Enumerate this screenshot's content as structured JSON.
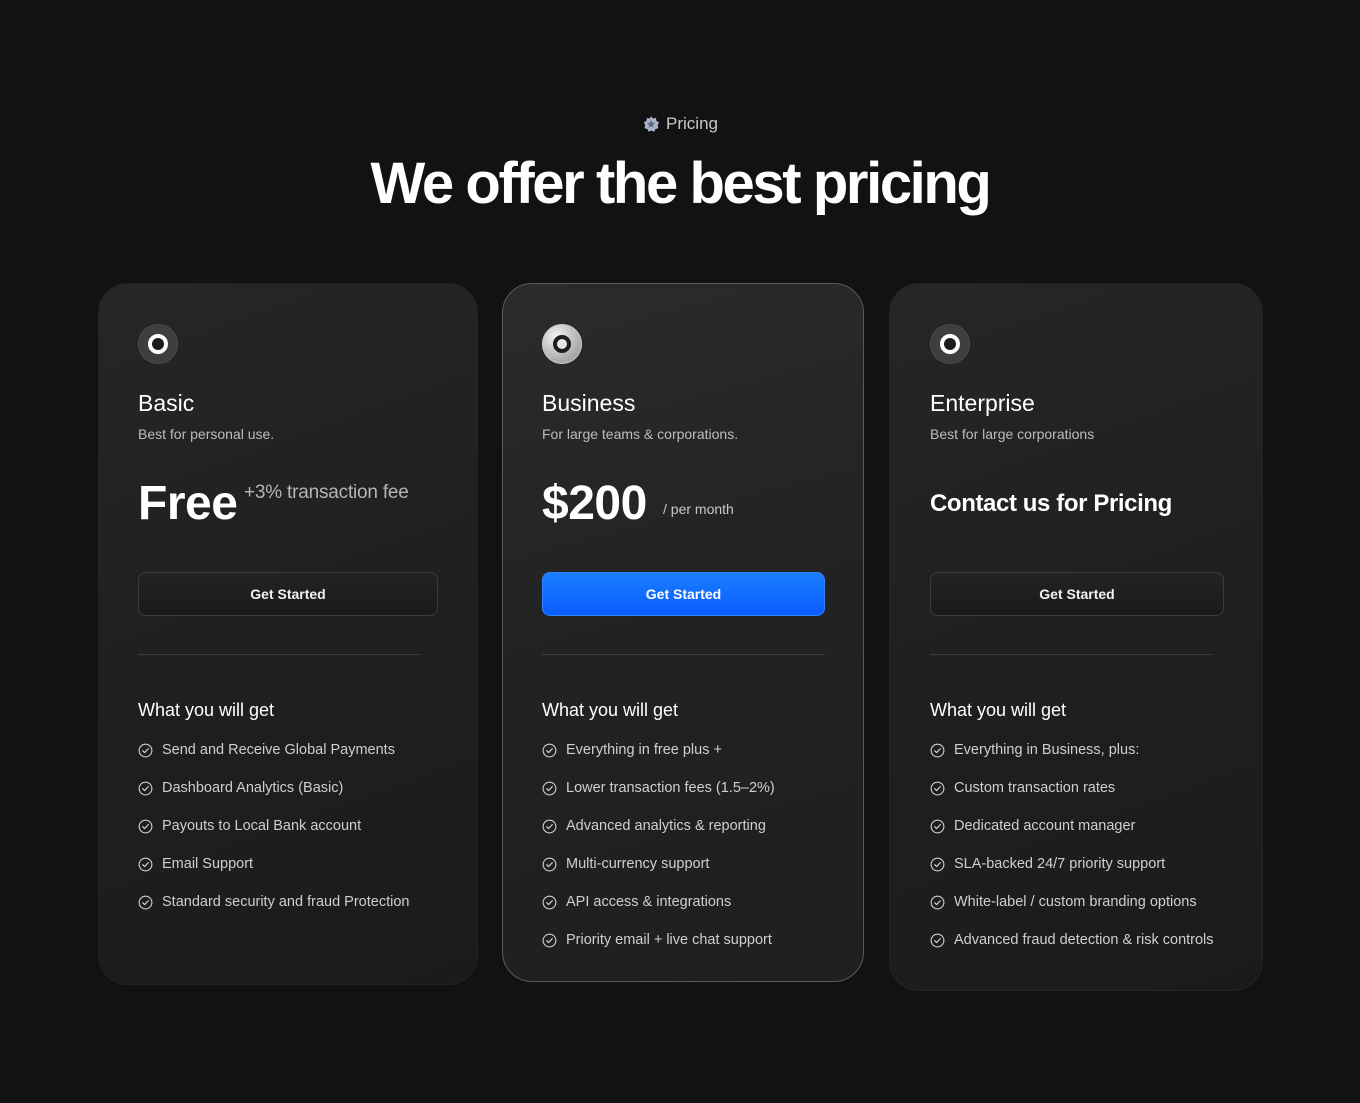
{
  "header": {
    "eyebrow": "Pricing",
    "eyebrow_icon": "badge-star-icon",
    "title": "We offer the best pricing"
  },
  "colors": {
    "background": "#121212",
    "card": "#222222",
    "accent_blue": "#0a63ff",
    "text_muted": "#bdbdbd"
  },
  "plans": [
    {
      "name": "Basic",
      "description": "Best for personal use.",
      "price": "Free",
      "price_note": "+3% transaction fee",
      "cta": "Get Started",
      "features_title": "What you will get",
      "features": [
        "Send and Receive Global Payments",
        "Dashboard Analytics (Basic)",
        "Payouts to Local Bank account",
        "Email Support",
        "Standard security and fraud Protection"
      ]
    },
    {
      "name": "Business",
      "description": "For large teams & corporations.",
      "price": "$200",
      "price_note": "/ per month",
      "cta": "Get Started",
      "features_title": "What you will get",
      "features": [
        "Everything in free plus +",
        "Lower transaction fees (1.5–2%)",
        "Advanced analytics & reporting",
        "Multi-currency support",
        "API access & integrations",
        "Priority email + live chat support"
      ]
    },
    {
      "name": "Enterprise",
      "description": "Best for large corporations",
      "price": "Contact us for Pricing",
      "cta": "Get Started",
      "features_title": "What you will get",
      "features": [
        "Everything in Business, plus:",
        "Custom transaction rates",
        "Dedicated account manager",
        "SLA-backed 24/7 priority support",
        "White-label / custom branding options",
        "Advanced fraud detection & risk controls"
      ]
    }
  ]
}
